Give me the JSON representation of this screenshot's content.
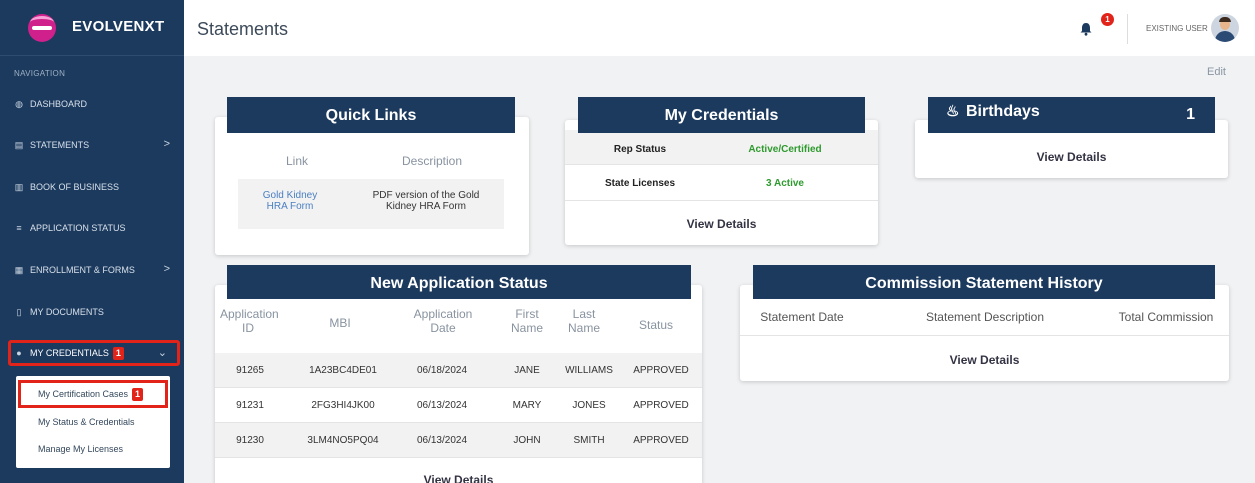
{
  "brand": {
    "name": "EVOLVENXT"
  },
  "nav": {
    "label": "NAVIGATION",
    "items": [
      {
        "label": "DASHBOARD",
        "icon": "dashboard-icon"
      },
      {
        "label": "STATEMENTS",
        "icon": "statements-icon",
        "chevron": ">"
      },
      {
        "label": "BOOK OF BUSINESS",
        "icon": "business-icon"
      },
      {
        "label": "APPLICATION STATUS",
        "icon": "list-icon"
      },
      {
        "label": "ENROLLMENT & FORMS",
        "icon": "forms-icon",
        "chevron": ">"
      },
      {
        "label": "MY DOCUMENTS",
        "icon": "document-icon"
      },
      {
        "label": "MY CREDENTIALS",
        "icon": "credentials-icon",
        "badge": "1",
        "chevron": "⌄"
      }
    ],
    "submenu": [
      {
        "label": "My Certification Cases",
        "badge": "1"
      },
      {
        "label": "My Status & Credentials"
      },
      {
        "label": "Manage My Licenses"
      }
    ]
  },
  "header": {
    "title": "Statements",
    "notification_count": "1",
    "user": "EXISTING USER",
    "edit": "Edit"
  },
  "quick_links": {
    "title": "Quick Links",
    "col_link": "Link",
    "col_desc": "Description",
    "rows": [
      {
        "link": "Gold Kidney HRA Form",
        "desc": "PDF version of the Gold Kidney HRA Form"
      }
    ]
  },
  "credentials": {
    "title": "My Credentials",
    "rows": [
      {
        "label": "Rep Status",
        "value": "Active/Certified"
      },
      {
        "label": "State Licenses",
        "value": "3 Active"
      }
    ],
    "view_details": "View Details"
  },
  "birthdays": {
    "title": "Birthdays",
    "count": "1",
    "view_details": "View Details"
  },
  "app_status": {
    "title": "New Application Status",
    "columns": [
      "Application ID",
      "MBI",
      "Application Date",
      "First Name",
      "Last Name",
      "Status"
    ],
    "rows": [
      [
        "91265",
        "1A23BC4DE01",
        "06/18/2024",
        "JANE",
        "WILLIAMS",
        "APPROVED"
      ],
      [
        "91231",
        "2FG3HI4JK00",
        "06/13/2024",
        "MARY",
        "JONES",
        "APPROVED"
      ],
      [
        "91230",
        "3LM4NO5PQ04",
        "06/13/2024",
        "JOHN",
        "SMITH",
        "APPROVED"
      ]
    ],
    "view_details": "View Details"
  },
  "commission": {
    "title": "Commission Statement History",
    "columns": [
      "Statement Date",
      "Statement Description",
      "Total Commission"
    ],
    "view_details": "View Details"
  },
  "colors": {
    "navy": "#1c3a5e",
    "highlight": "#e2231a",
    "link": "#4a7fc1",
    "green": "#2e9a2e"
  }
}
